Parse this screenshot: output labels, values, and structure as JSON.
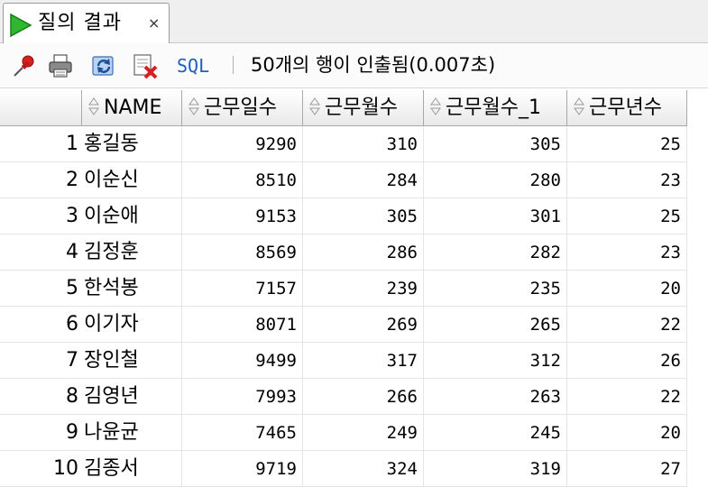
{
  "tab": {
    "title": "질의 결과",
    "close_glyph": "×",
    "run_icon": "run-triangle-icon"
  },
  "toolbar": {
    "icons": [
      "pin-icon",
      "print-icon",
      "refresh-icon",
      "delete-icon"
    ],
    "sql_label": "SQL",
    "separator": "|",
    "status": "50개의 행이 인출됨(0.007초)"
  },
  "grid": {
    "columns": [
      "NAME",
      "근무일수",
      "근무월수",
      "근무월수_1",
      "근무년수"
    ],
    "rows": [
      {
        "n": "1",
        "name": "홍길동",
        "days": "9290",
        "months": "310",
        "months_1": "305",
        "years": "25"
      },
      {
        "n": "2",
        "name": "이순신",
        "days": "8510",
        "months": "284",
        "months_1": "280",
        "years": "23"
      },
      {
        "n": "3",
        "name": "이순애",
        "days": "9153",
        "months": "305",
        "months_1": "301",
        "years": "25"
      },
      {
        "n": "4",
        "name": "김정훈",
        "days": "8569",
        "months": "286",
        "months_1": "282",
        "years": "23"
      },
      {
        "n": "5",
        "name": "한석봉",
        "days": "7157",
        "months": "239",
        "months_1": "235",
        "years": "20"
      },
      {
        "n": "6",
        "name": "이기자",
        "days": "8071",
        "months": "269",
        "months_1": "265",
        "years": "22"
      },
      {
        "n": "7",
        "name": "장인철",
        "days": "9499",
        "months": "317",
        "months_1": "312",
        "years": "26"
      },
      {
        "n": "8",
        "name": "김영년",
        "days": "7993",
        "months": "266",
        "months_1": "263",
        "years": "22"
      },
      {
        "n": "9",
        "name": "나윤균",
        "days": "7465",
        "months": "249",
        "months_1": "245",
        "years": "20"
      },
      {
        "n": "10",
        "name": "김종서",
        "days": "9719",
        "months": "324",
        "months_1": "319",
        "years": "27"
      }
    ]
  }
}
